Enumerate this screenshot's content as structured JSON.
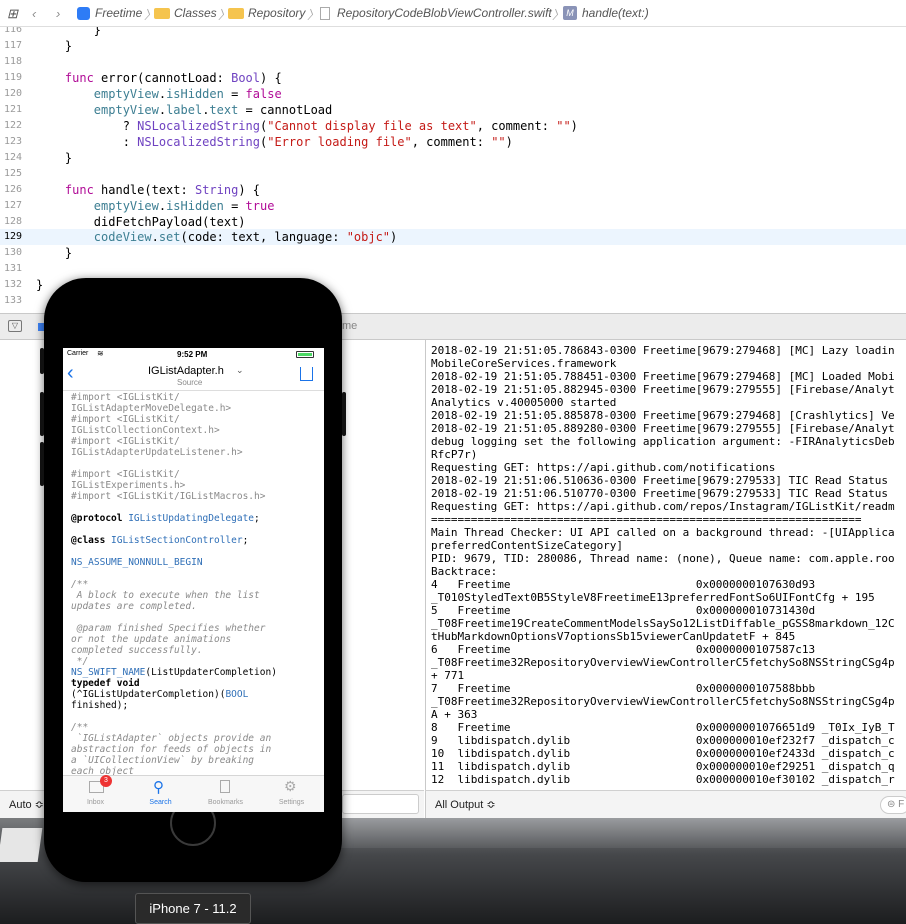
{
  "jumpbar": {
    "items": [
      "Freetime",
      "Classes",
      "Repository",
      "RepositoryCodeBlobViewController.swift",
      "handle(text:)"
    ]
  },
  "editor": {
    "lines": [
      {
        "n": "116",
        "code": "        }"
      },
      {
        "n": "117",
        "code": "    }"
      },
      {
        "n": "118",
        "code": ""
      },
      {
        "n": "119",
        "code": "    func error(cannotLoad: Bool) {"
      },
      {
        "n": "120",
        "code": "        emptyView.isHidden = false"
      },
      {
        "n": "121",
        "code": "        emptyView.label.text = cannotLoad"
      },
      {
        "n": "122",
        "code": "            ? NSLocalizedString(\"Cannot display file as text\", comment: \"\")"
      },
      {
        "n": "123",
        "code": "            : NSLocalizedString(\"Error loading file\", comment: \"\")"
      },
      {
        "n": "124",
        "code": "    }"
      },
      {
        "n": "125",
        "code": ""
      },
      {
        "n": "126",
        "code": "    func handle(text: String) {"
      },
      {
        "n": "127",
        "code": "        emptyView.isHidden = true"
      },
      {
        "n": "128",
        "code": "        didFetchPayload(text)"
      },
      {
        "n": "129",
        "code": "        codeView.set(code: text, language: \"objc\")"
      },
      {
        "n": "130",
        "code": "    }"
      },
      {
        "n": "131",
        "code": ""
      },
      {
        "n": "132",
        "code": "}"
      },
      {
        "n": "133",
        "code": ""
      }
    ]
  },
  "debug_toolbar": {
    "target_label": "me"
  },
  "variables": {
    "filter_label": "Auto ≎"
  },
  "console": {
    "lines": [
      "2018-02-19 21:51:05.786843-0300 Freetime[9679:279468] [MC] Lazy loadin",
      "MobileCoreServices.framework",
      "2018-02-19 21:51:05.788451-0300 Freetime[9679:279468] [MC] Loaded Mobi",
      "2018-02-19 21:51:05.882945-0300 Freetime[9679:279555] [Firebase/Analyt",
      "Analytics v.40005000 started",
      "2018-02-19 21:51:05.885878-0300 Freetime[9679:279468] [Crashlytics] Ve",
      "2018-02-19 21:51:05.889280-0300 Freetime[9679:279555] [Firebase/Analyt",
      "debug logging set the following application argument: -FIRAnalyticsDeb",
      "RfcP7r)",
      "Requesting GET: https://api.github.com/notifications",
      "2018-02-19 21:51:06.510636-0300 Freetime[9679:279533] TIC Read Status",
      "2018-02-19 21:51:06.510770-0300 Freetime[9679:279533] TIC Read Status",
      "Requesting GET: https://api.github.com/repos/Instagram/IGListKit/readm",
      "=================================================================",
      "Main Thread Checker: UI API called on a background thread: -[UIApplica",
      "preferredContentSizeCategory]",
      "PID: 9679, TID: 280086, Thread name: (none), Queue name: com.apple.roo",
      "Backtrace:",
      "4   Freetime                            0x0000000107630d93",
      "_T010StyledText0B5StyleV8FreetimeE13preferredFontSo6UIFontCfg + 195",
      "5   Freetime                            0x000000010731430d",
      "_T08Freetime19CreateCommentModelsSaySo12ListDiffable_pGSS8markdown_12C",
      "tHubMarkdownOptionsV7optionsSb15viewerCanUpdatetF + 845",
      "6   Freetime                            0x0000000107587c13",
      "_T08Freetime32RepositoryOverviewViewControllerC5fetchySo8NSStringCSg4p",
      "+ 771",
      "7   Freetime                            0x0000000107588bbb",
      "_T08Freetime32RepositoryOverviewViewControllerC5fetchySo8NSStringCSg4p",
      "A + 363",
      "8   Freetime                            0x00000001076651d9 _T0Ix_IyB_T",
      "9   libdispatch.dylib                   0x000000010ef232f7 _dispatch_c",
      "10  libdispatch.dylib                   0x000000010ef2433d _dispatch_c",
      "11  libdispatch.dylib                   0x000000010ef29251 _dispatch_q",
      "12  libdispatch.dylib                   0x000000010ef30102 _dispatch_r"
    ],
    "output_filter": "All Output ≎"
  },
  "simulator": {
    "device_label": "iPhone 7 - 11.2",
    "status": {
      "carrier": "Carrier",
      "time": "9:52 PM"
    },
    "nav": {
      "title": "IGListAdapter.h",
      "subtitle": "Source"
    },
    "tabs": [
      {
        "label": "Inbox",
        "badge": "3"
      },
      {
        "label": "Search"
      },
      {
        "label": "Bookmarks"
      },
      {
        "label": "Settings"
      }
    ]
  }
}
